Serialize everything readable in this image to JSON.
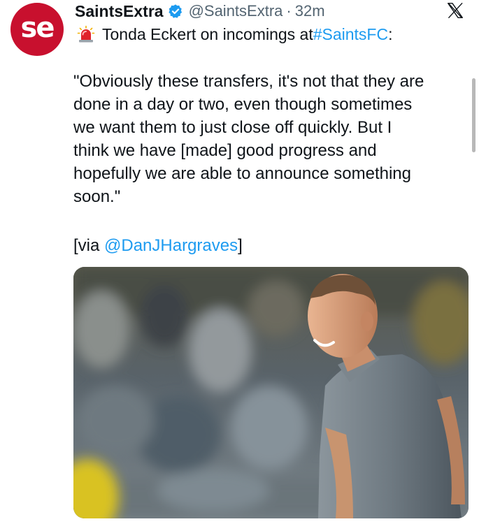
{
  "tweet": {
    "display_name": "SaintsExtra",
    "handle": "@SaintsExtra",
    "separator": "·",
    "time": "32m",
    "avatar_text": "se",
    "line1_prefix": "Tonda Eckert on incomings at ",
    "hashtag": "#SaintsFC",
    "line1_suffix": ":",
    "quote_lines": [
      "\"Obviously these transfers, it's not that they are",
      "done in a day or two, even though sometimes",
      "we want them to just close off quickly. But I",
      "think we have [made] good progress and",
      "hopefully we are able to announce something",
      "soon.\""
    ],
    "via_prefix": "[via ",
    "via_mention": "@DanJHargraves",
    "via_suffix": "]"
  },
  "colors": {
    "brand_red": "#c8102e",
    "link_blue": "#1d9bf0",
    "text": "#0f1419",
    "muted": "#536471"
  },
  "icons": {
    "verified": "verified-badge-icon",
    "siren": "police-light-emoji-icon",
    "x_logo": "x-logo-icon"
  }
}
